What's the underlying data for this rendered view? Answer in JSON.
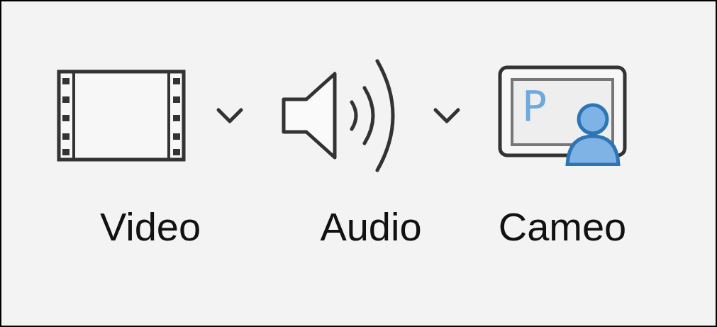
{
  "ribbon": {
    "buttons": [
      {
        "kind": "video",
        "label": "Video",
        "has_menu": true
      },
      {
        "kind": "audio",
        "label": "Audio",
        "has_menu": true
      },
      {
        "kind": "cameo",
        "label": "Cameo",
        "has_menu": false,
        "glyph": "P"
      }
    ]
  }
}
